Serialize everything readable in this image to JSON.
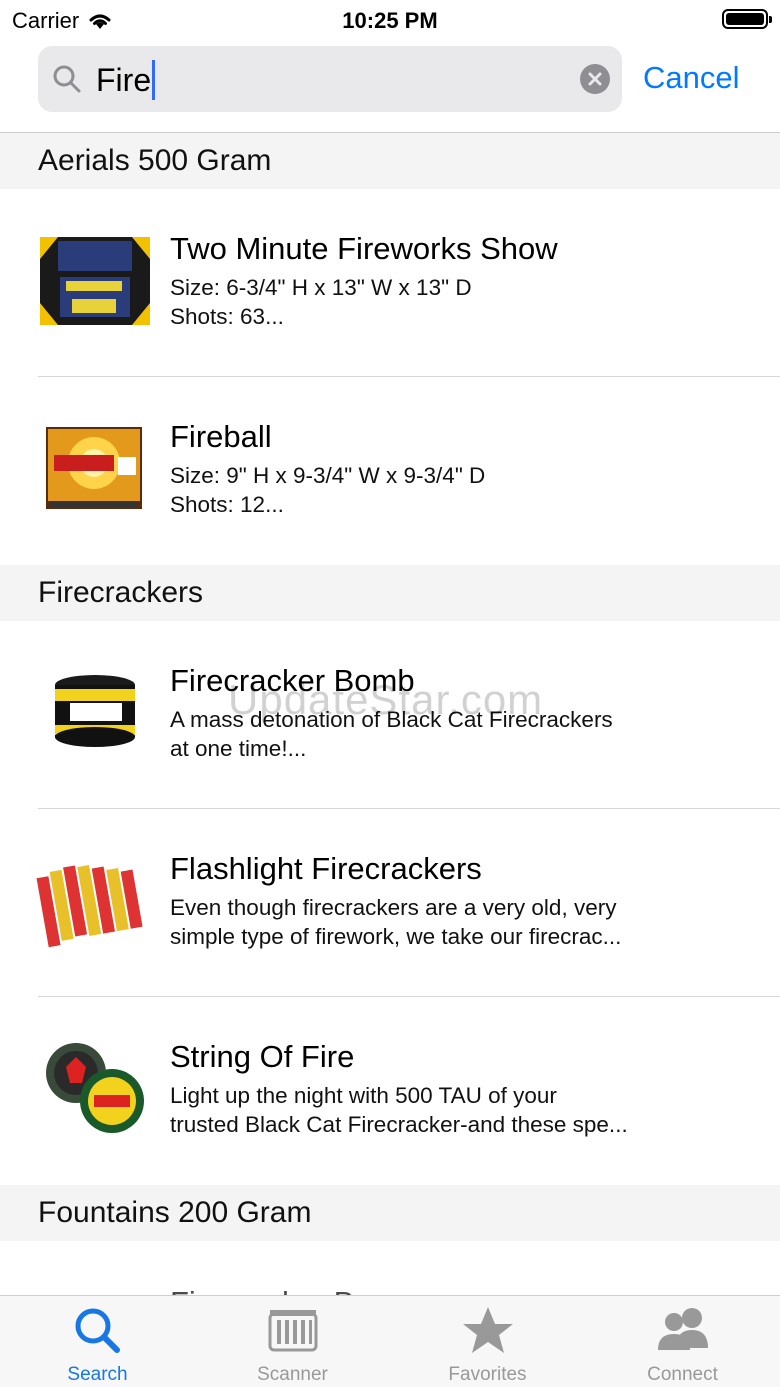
{
  "status_bar": {
    "carrier": "Carrier",
    "time": "10:25 PM"
  },
  "search": {
    "query": "Fire",
    "cancel_label": "Cancel"
  },
  "sections": [
    {
      "title": "Aerials 500 Gram",
      "items": [
        {
          "title": "Two Minute Fireworks Show",
          "line1": "Size: 6-3/4\" H x 13\" W x 13\" D",
          "line2": "Shots: 63..."
        },
        {
          "title": "Fireball",
          "line1": "Size: 9\" H x 9-3/4\" W x 9-3/4\" D",
          "line2": "Shots: 12..."
        }
      ]
    },
    {
      "title": "Firecrackers",
      "items": [
        {
          "title": "Firecracker Bomb",
          "line1": "A mass detonation of Black Cat Firecrackers",
          "line2": "at one time!..."
        },
        {
          "title": "Flashlight Firecrackers",
          "line1": "Even though firecrackers are a very old, very",
          "line2": "simple type of firework, we take our firecrac..."
        },
        {
          "title": "String Of Fire",
          "line1": "Light up the night with 500 TAU of your",
          "line2": "trusted Black Cat Firecracker-and these spe..."
        }
      ]
    },
    {
      "title": "Fountains 200 Gram",
      "items": [
        {
          "title": "Firecracker Barrage"
        }
      ]
    }
  ],
  "watermark": "UpdateStar.com",
  "tabs": [
    {
      "label": "Search",
      "icon": "search-icon",
      "active": true
    },
    {
      "label": "Scanner",
      "icon": "barcode-scanner-icon",
      "active": false
    },
    {
      "label": "Favorites",
      "icon": "star-icon",
      "active": false
    },
    {
      "label": "Connect",
      "icon": "people-icon",
      "active": false
    }
  ],
  "colors": {
    "accent": "#007aff",
    "tab_active": "#1677e5",
    "tab_inactive": "#999999",
    "section_bg": "#f4f4f4"
  }
}
